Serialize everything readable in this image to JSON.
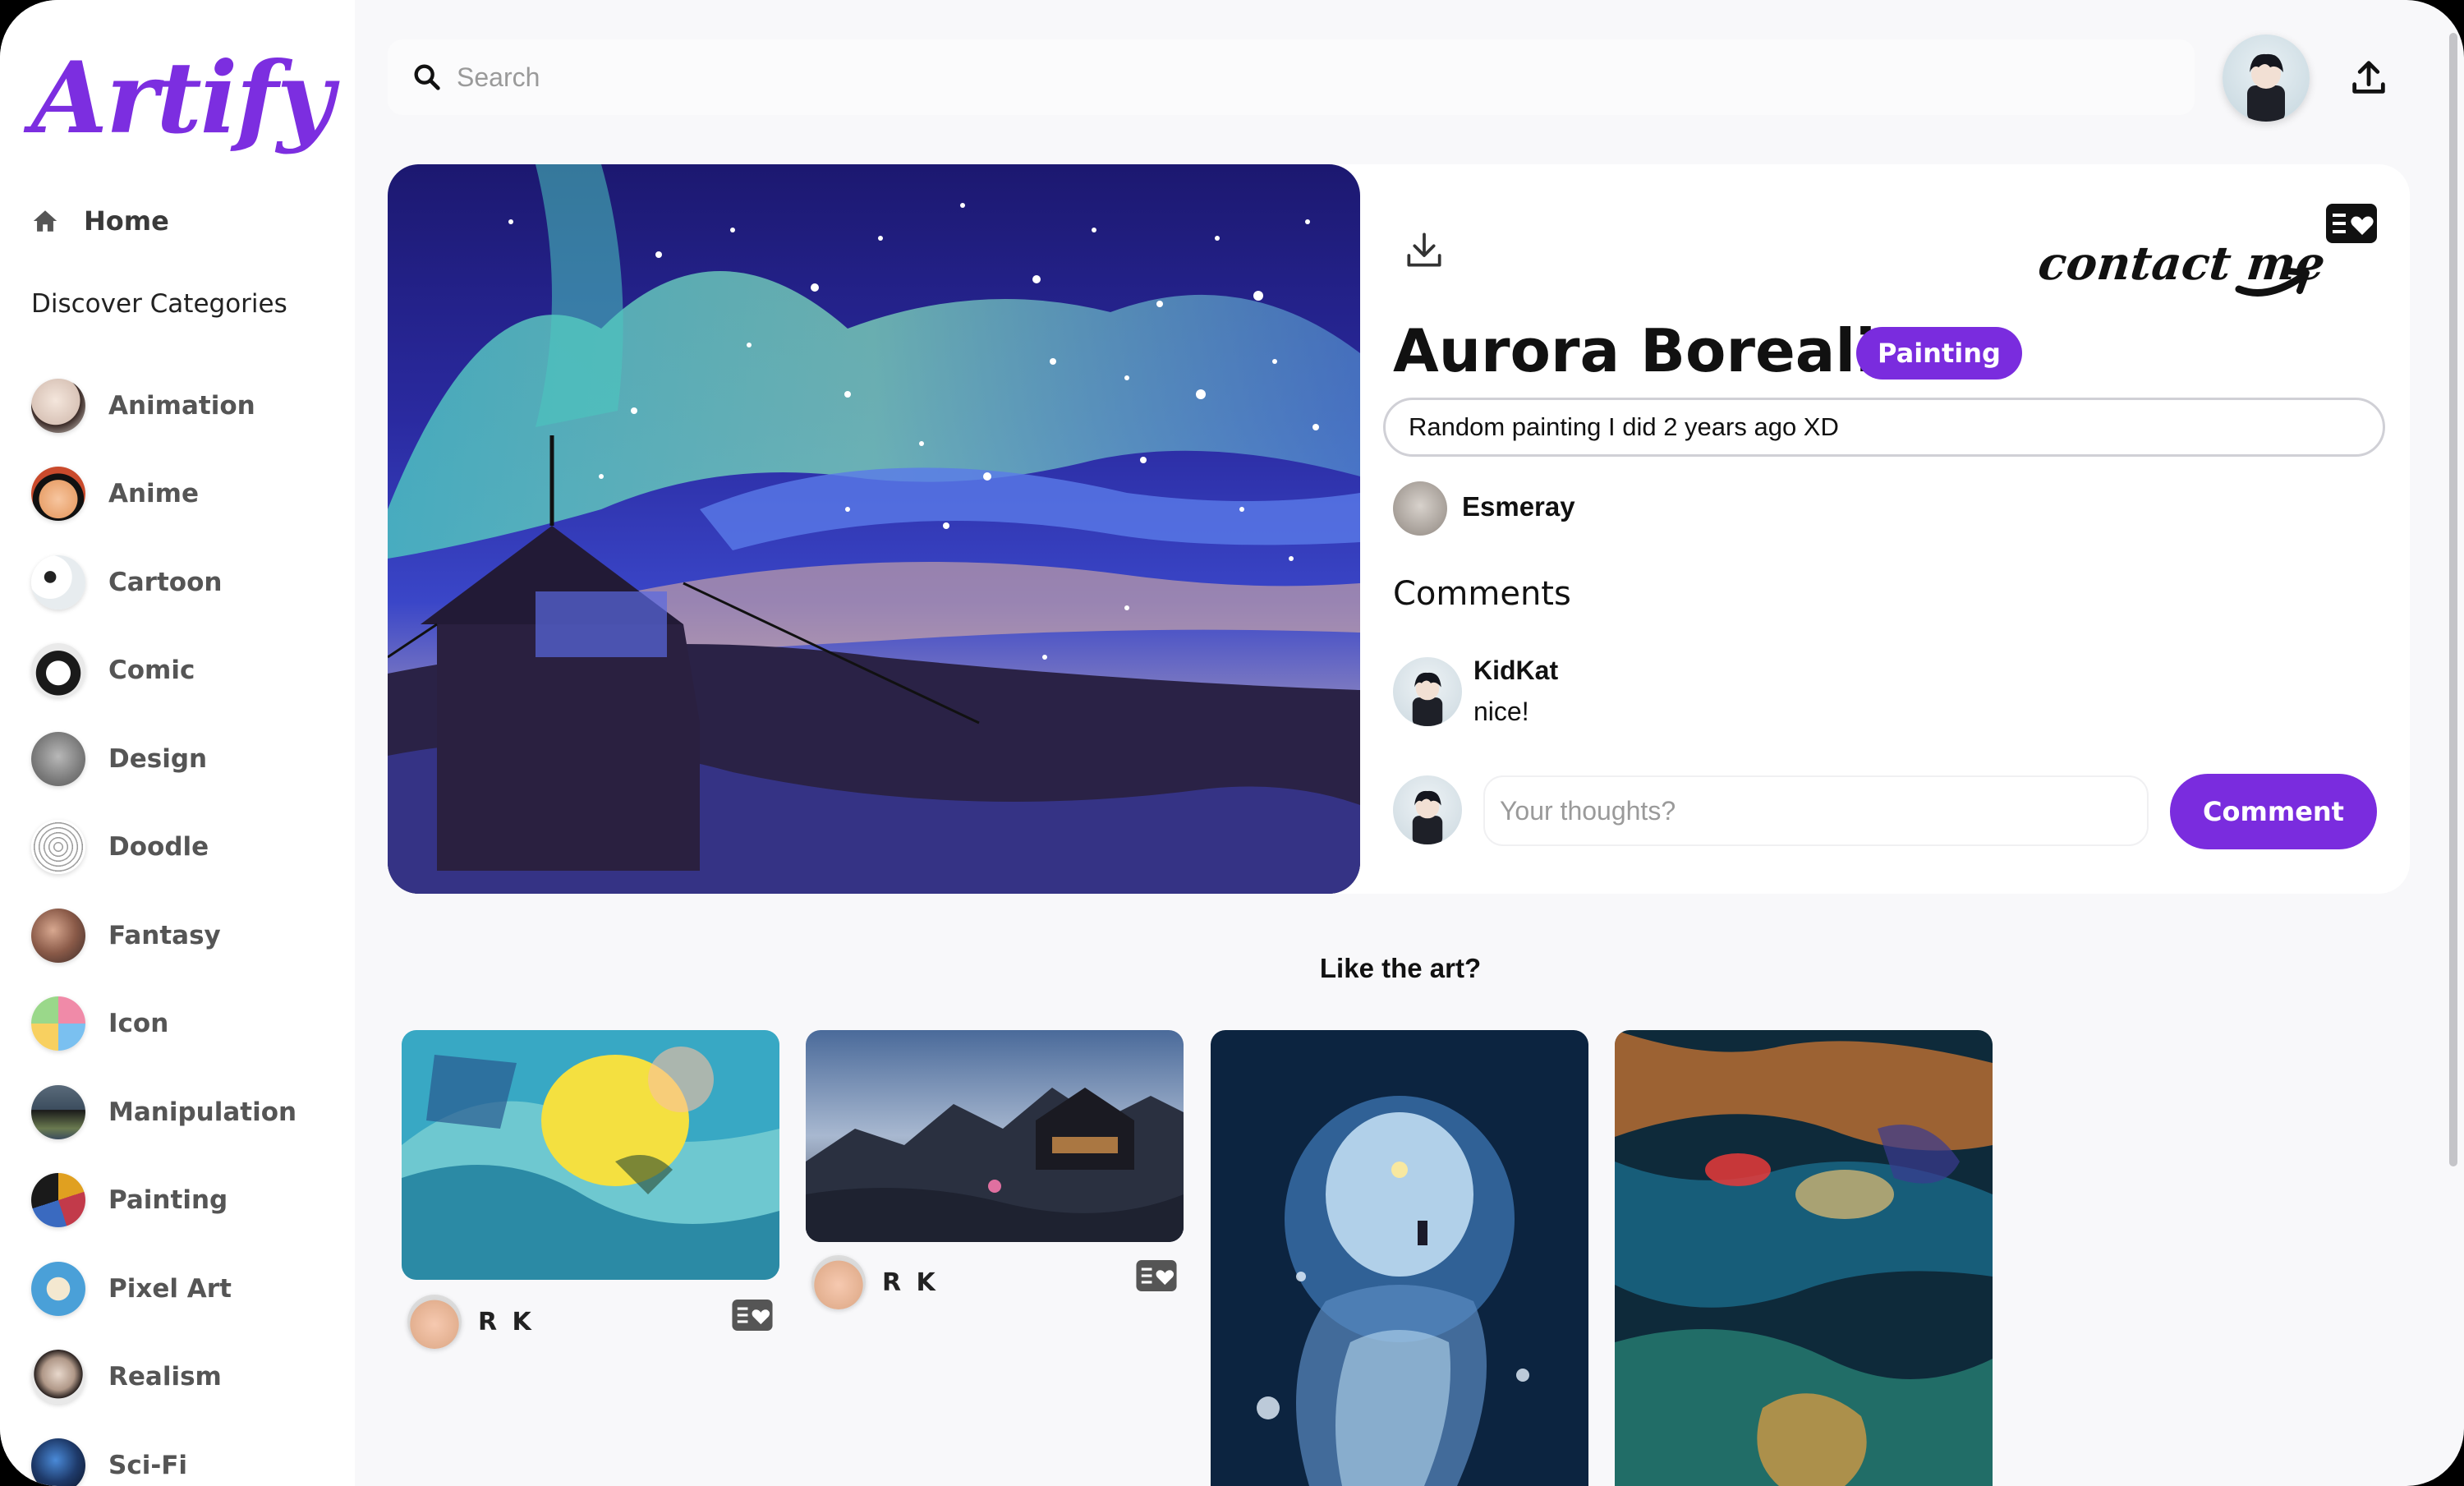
{
  "app": {
    "logo": "Artify"
  },
  "sidebar": {
    "home_label": "Home",
    "discover_heading": "Discover Categories",
    "categories": [
      {
        "label": "Animation",
        "color": "#d9c4b8"
      },
      {
        "label": "Anime",
        "color": "#c94a2c"
      },
      {
        "label": "Cartoon",
        "color": "#e7ecef"
      },
      {
        "label": "Comic",
        "color": "#d0d0d0"
      },
      {
        "label": "Design",
        "color": "#8c8c8c"
      },
      {
        "label": "Doodle",
        "color": "#b0b0b0"
      },
      {
        "label": "Fantasy",
        "color": "#7a5a48"
      },
      {
        "label": "Icon",
        "color": "#f0b0c8"
      },
      {
        "label": "Manipulation",
        "color": "#3c4d5e"
      },
      {
        "label": "Painting",
        "color": "#c23a4a"
      },
      {
        "label": "Pixel Art",
        "color": "#4aa0d8"
      },
      {
        "label": "Realism",
        "color": "#6a5a52"
      },
      {
        "label": "Sci-Fi",
        "color": "#1e3a6a"
      }
    ]
  },
  "search": {
    "placeholder": "Search"
  },
  "post": {
    "title": "Aurora Borealis",
    "category": "Painting",
    "description": "Random painting I did 2 years ago XD",
    "author": "Esmeray",
    "contact_label": "contact me",
    "comments_heading": "Comments",
    "comments": [
      {
        "author": "KidKat",
        "text": "nice!"
      }
    ],
    "comment_placeholder": "Your thoughts?",
    "comment_button": "Comment"
  },
  "related": {
    "heading": "Like the art?",
    "items": [
      {
        "author": "R K"
      },
      {
        "author": "R K"
      },
      {
        "author": ""
      },
      {
        "author": ""
      }
    ]
  },
  "colors": {
    "accent": "#7a2cde"
  }
}
